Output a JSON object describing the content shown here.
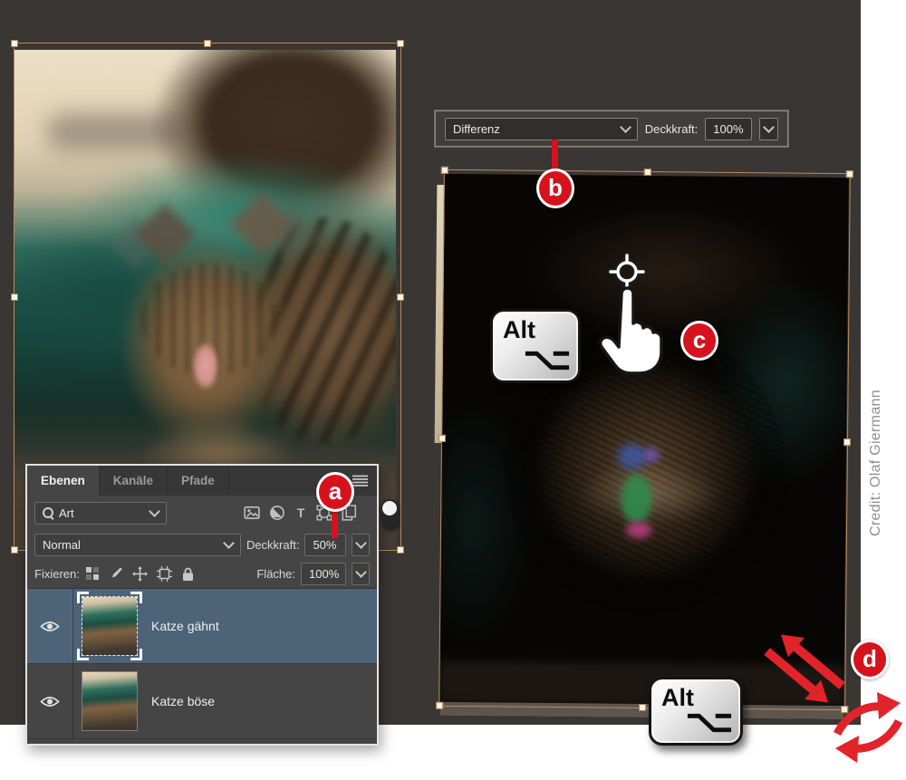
{
  "colors": {
    "canvas_bg": "#3a3633",
    "accent_red": "#d6131c",
    "selected_layer_row": "#4d6378",
    "transform_box": "#bb8c5c"
  },
  "blend_bar": {
    "mode": "Differenz",
    "opacity_label": "Deckkraft:",
    "opacity_value": "100%"
  },
  "layers_panel": {
    "tabs": [
      {
        "label": "Ebenen"
      },
      {
        "label": "Kanäle"
      },
      {
        "label": "Pfade"
      }
    ],
    "search_value": "Art",
    "blend_mode": "Normal",
    "opacity_label": "Deckkraft:",
    "opacity_value": "50%",
    "lock_label": "Fixieren:",
    "fill_label": "Fläche:",
    "fill_value": "100%",
    "layers": [
      {
        "name": "Katze gähnt"
      },
      {
        "name": "Katze böse"
      }
    ]
  },
  "callouts": {
    "a": "a",
    "b": "b",
    "c": "c",
    "d": "d"
  },
  "alt_key_label": "Alt",
  "credit": "Credit: Olaf Giermann"
}
